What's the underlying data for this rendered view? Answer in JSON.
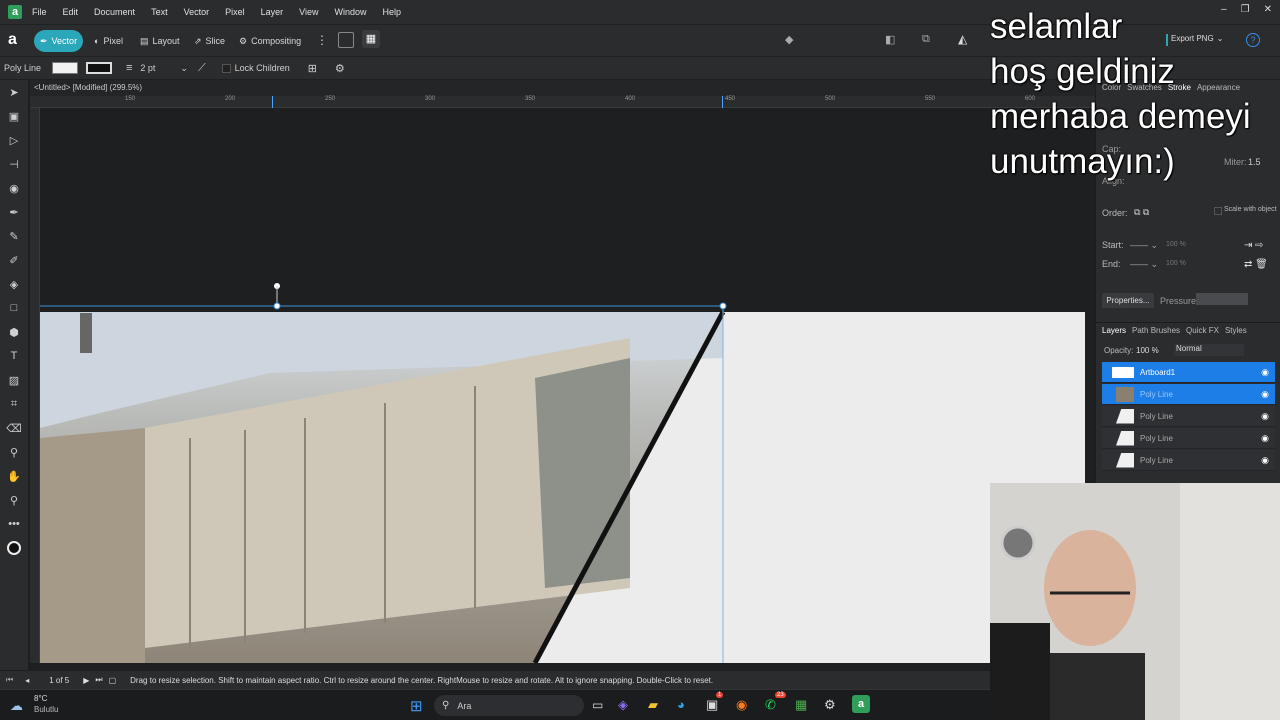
{
  "menu": [
    "File",
    "Edit",
    "Document",
    "Text",
    "Vector",
    "Pixel",
    "Layer",
    "View",
    "Window",
    "Help"
  ],
  "personas": [
    {
      "label": "Vector",
      "active": true
    },
    {
      "label": "Pixel",
      "active": false
    },
    {
      "label": "Layout",
      "active": false
    },
    {
      "label": "Slice",
      "active": false
    },
    {
      "label": "Compositing",
      "active": false
    }
  ],
  "export_label": "Export PNG",
  "context": {
    "tool_name": "Poly Line",
    "stroke_width": "2 pt",
    "lock_children": "Lock Children"
  },
  "doc_tab": "<Untitled> [Modified] (299.5%)",
  "ruler_ticks": [
    "150",
    "200",
    "250",
    "300",
    "350",
    "400",
    "450",
    "500",
    "550",
    "600"
  ],
  "panel": {
    "tabs": [
      "Color",
      "Swatches",
      "Stroke",
      "Appearance"
    ],
    "active_tab": "Stroke",
    "cap_label": "Cap:",
    "align_label": "Align:",
    "miter_label": "Miter:",
    "miter_value": "1.5",
    "order_label": "Order:",
    "scale_label": "Scale with object",
    "start_label": "Start:",
    "end_label": "End:",
    "start_pct": "100 %",
    "end_pct": "100 %",
    "properties_btn": "Properties...",
    "pressure_label": "Pressure:"
  },
  "layers_panel": {
    "tabs": [
      "Layers",
      "Path Brushes",
      "Quick FX",
      "Styles"
    ],
    "opacity_label": "Opacity:",
    "opacity_value": "100 %",
    "blend_mode": "Normal",
    "layers": [
      {
        "name": "Artboard1",
        "type": "artboard",
        "selected": true
      },
      {
        "name": "Poly Line",
        "type": "image",
        "selected": true
      },
      {
        "name": "Poly Line",
        "type": "shape",
        "selected": false
      },
      {
        "name": "Poly Line",
        "type": "shape",
        "selected": false
      },
      {
        "name": "Poly Line",
        "type": "shape",
        "selected": false
      }
    ]
  },
  "status": {
    "page": "1 of 5",
    "hint": "Drag to resize selection. Shift to maintain aspect ratio. Ctrl to resize around the center. RightMouse to resize and rotate. Alt to ignore snapping. Double-Click to reset."
  },
  "taskbar": {
    "temp": "8°C",
    "weather": "Bulutlu",
    "search": "Ara",
    "badge1": "1",
    "badge2": "23"
  },
  "overlay_text": "selamlar\nhoş geldiniz\nmerhaba demeyi\nunutmayın:)",
  "colors": {
    "accent": "#2aa7b8",
    "selection": "#1d7ee8",
    "bg": "#1e1f21",
    "panel": "#2b2c2e",
    "export": "#2aa7b8"
  }
}
